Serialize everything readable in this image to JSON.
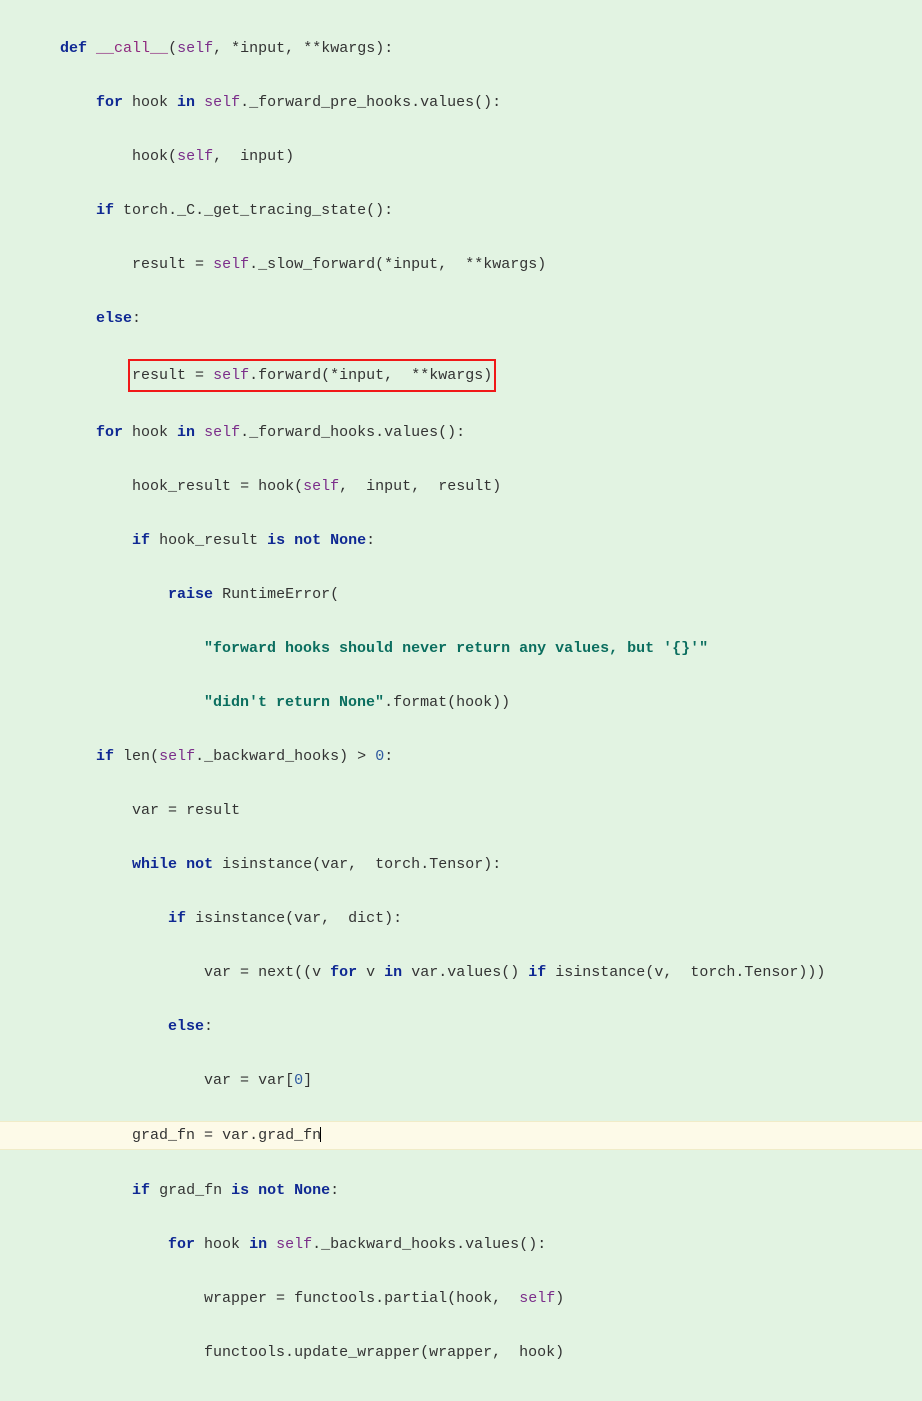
{
  "code": {
    "line1": {
      "kw_def": "def",
      "fname": "__call__",
      "args_open": "(",
      "self": "self",
      "c1": ",",
      "sp1": " ",
      "star": "*",
      "input": "input",
      "c2": ",",
      "sp2": " ",
      "starstar": "**",
      "kwargs": "kwargs",
      "close": "):"
    },
    "line2": {
      "kw_for": "for",
      "hook": " hook ",
      "kw_in": "in",
      "sp": " ",
      "self": "self",
      "dot": ".",
      "attr": "_forward_pre_hooks",
      "dot2": ".",
      "method": "values",
      "call": "():"
    },
    "line3": {
      "fn": "hook",
      "open": "(",
      "self": "self",
      "c": ",",
      "sp": "  ",
      "arg": "input",
      "close": ")"
    },
    "line4": {
      "kw_if": "if",
      "sp": " ",
      "mod": "torch",
      "d1": ".",
      "attr": "_C",
      "d2": ".",
      "fn": "_get_tracing_state",
      "call": "():"
    },
    "line5": {
      "lhs": "result ",
      "eq": "=",
      "sp": " ",
      "self": "self",
      "d": ".",
      "fn": "_slow_forward",
      "open": "(",
      "s1": "*",
      "a1": "input",
      "c": ",",
      "sp2": "  ",
      "s2": "**",
      "a2": "kwargs",
      "close": ")"
    },
    "line6": {
      "kw": "else",
      "colon": ":"
    },
    "line7": {
      "lhs": "result ",
      "eq": "=",
      "sp": " ",
      "self": "self",
      "d": ".",
      "fn": "forward",
      "open": "(",
      "s1": "*",
      "a1": "input",
      "c": ",",
      "sp2": "  ",
      "s2": "**",
      "a2": "kwargs",
      "close": ")"
    },
    "line8": {
      "kw_for": "for",
      "hook": " hook ",
      "kw_in": "in",
      "sp": " ",
      "self": "self",
      "d": ".",
      "attr": "_forward_hooks",
      "d2": ".",
      "fn": "values",
      "call": "():"
    },
    "line9": {
      "lhs": "hook_result ",
      "eq": "=",
      "sp": " ",
      "fn": "hook",
      "open": "(",
      "self": "self",
      "c1": ",",
      "sp1": "  ",
      "a1": "input",
      "c2": ",",
      "sp2": "  ",
      "a2": "result",
      "close": ")"
    },
    "line10": {
      "kw_if": "if",
      "sp": " ",
      "var": "hook_result ",
      "kw_isnot": "is not",
      "sp2": " ",
      "none": "None",
      "colon": ":"
    },
    "line11": {
      "kw": "raise",
      "sp": " ",
      "cls": "RuntimeError",
      "open": "("
    },
    "line12": {
      "str": "\"forward hooks should never return any values, but '{}'\""
    },
    "line13": {
      "str": "\"didn't return None\"",
      "d": ".",
      "fn": "format",
      "open": "(",
      "arg": "hook",
      "close": "))"
    },
    "line14": {
      "kw_if": "if",
      "sp": " ",
      "fn": "len",
      "open": "(",
      "self": "self",
      "d": ".",
      "attr": "_backward_hooks",
      "close": ") ",
      "op": ">",
      "sp2": " ",
      "num": "0",
      "colon": ":"
    },
    "line15": {
      "lhs": "var ",
      "eq": "=",
      "sp": " ",
      "rhs": "result"
    },
    "line16": {
      "kw_while": "while",
      "sp": " ",
      "kw_not": "not",
      "sp2": " ",
      "fn": "isinstance",
      "open": "(",
      "a1": "var",
      "c": ",",
      "sp3": "  ",
      "mod": "torch",
      "d": ".",
      "cls": "Tensor",
      "close": "):"
    },
    "line17": {
      "kw_if": "if",
      "sp": " ",
      "fn": "isinstance",
      "open": "(",
      "a1": "var",
      "c": ",",
      "sp2": "  ",
      "cls": "dict",
      "close": "):"
    },
    "line18": {
      "lhs": "var ",
      "eq": "=",
      "sp": " ",
      "fn": "next",
      "open": "((",
      "v": "v ",
      "kw_for": "for",
      "sp2": " ",
      "v2": "v ",
      "kw_in": "in",
      "sp3": " ",
      "obj": "var",
      "d": ".",
      "m": "values",
      "call": "() ",
      "kw_if": "if",
      "sp4": " ",
      "fn2": "isinstance",
      "open2": "(",
      "a": "v",
      "c": ",",
      "sp5": "  ",
      "mod": "torch",
      "d2": ".",
      "cls": "Tensor",
      "close": ")))"
    },
    "line19": {
      "kw": "else",
      "colon": ":"
    },
    "line20": {
      "lhs": "var ",
      "eq": "=",
      "sp": " ",
      "rhs": "var",
      "open": "[",
      "idx": "0",
      "close": "]"
    },
    "line21": {
      "lhs": "grad_fn ",
      "eq": "=",
      "sp": " ",
      "rhs": "var",
      "d": ".",
      "attr": "grad_fn"
    },
    "line22": {
      "kw_if": "if",
      "sp": " ",
      "var": "grad_fn ",
      "kw_isnot": "is not",
      "sp2": " ",
      "none": "None",
      "colon": ":"
    },
    "line23": {
      "kw_for": "for",
      "hook": " hook ",
      "kw_in": "in",
      "sp": " ",
      "self": "self",
      "d": ".",
      "attr": "_backward_hooks",
      "d2": ".",
      "fn": "values",
      "call": "():"
    },
    "line24": {
      "lhs": "wrapper ",
      "eq": "=",
      "sp": " ",
      "mod": "functools",
      "d": ".",
      "fn": "partial",
      "open": "(",
      "a1": "hook",
      "c": ",",
      "sp2": "  ",
      "self": "self",
      "close": ")"
    },
    "line25": {
      "mod": "functools",
      "d": ".",
      "fn": "update_wrapper",
      "open": "(",
      "a1": "wrapper",
      "c": ",",
      "sp": "  ",
      "a2": "hook",
      "close": ")"
    }
  }
}
